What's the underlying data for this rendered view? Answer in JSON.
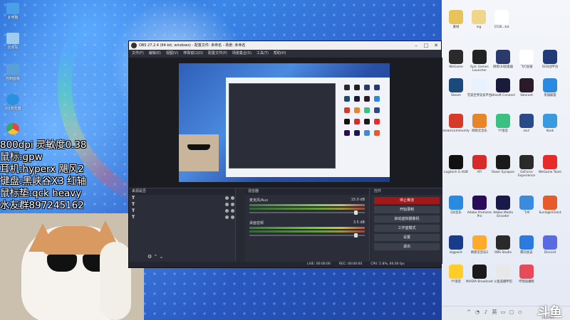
{
  "desktop": {
    "left_icons": [
      {
        "label": "此电脑",
        "icon": "computer-icon",
        "color": "#4aa0e8"
      },
      {
        "label": "回收站",
        "icon": "recycle-bin-icon",
        "color": "#9ecbf0"
      },
      {
        "label": "控制面板",
        "icon": "control-panel-icon",
        "color": "#5aa0d8"
      },
      {
        "label": "QQ浏览器",
        "icon": "qq-browser-icon",
        "color": "#2d8fe0"
      },
      {
        "label": "",
        "icon": "chrome-icon",
        "color": "#e04a3a"
      }
    ],
    "right_top_icons": [
      {
        "label": "素材",
        "icon": "folder-icon",
        "color": "#e8c25a"
      },
      {
        "label": "ing",
        "icon": "folder-icon",
        "color": "#f0d68a"
      },
      {
        "label": "1536...txt",
        "icon": "text-file-icon",
        "color": "#ffffff"
      }
    ],
    "right_icons": [
      {
        "label": "WeGame",
        "icon": "wegame-icon",
        "color": "#2a2a2a"
      },
      {
        "label": "Epic Games Launcher",
        "icon": "epic-icon",
        "color": "#222"
      },
      {
        "label": "网易UU加速器",
        "icon": "se-icon",
        "color": "#2a3a6a"
      },
      {
        "label": "飞行加速",
        "icon": "plane-icon",
        "color": "#ffffff"
      },
      {
        "label": "5E对战平台",
        "icon": "5e-icon",
        "color": "#203b78"
      },
      {
        "label": "Steam",
        "icon": "steam-icon",
        "color": "#1b4a7a"
      },
      {
        "label": "完美世界竞技平台",
        "icon": "perfect-icon",
        "color": "#e8f2ff"
      },
      {
        "label": "Ubisoft Connect",
        "icon": "ubisoft-icon",
        "color": "#1a1a3a"
      },
      {
        "label": "Valorant",
        "icon": "valorant-icon",
        "color": "#2a1a2a"
      },
      {
        "label": "英雄联盟",
        "icon": "league-icon",
        "color": "#2a8ae0"
      },
      {
        "label": "steamcommunity",
        "icon": "steamcommunity-icon",
        "color": "#d83a2a"
      },
      {
        "label": "网易云音乐",
        "icon": "cloudmusic-icon",
        "color": "#e8842a"
      },
      {
        "label": "YY语音",
        "icon": "yy-icon",
        "color": "#3ac080"
      },
      {
        "label": "osu!",
        "icon": "osu-icon",
        "color": "#2a4a8a"
      },
      {
        "label": "Kook",
        "icon": "kook-icon",
        "color": "#3a9ae0"
      },
      {
        "label": "Logitech G HUB",
        "icon": "ghub-icon",
        "color": "#111"
      },
      {
        "label": "ATI",
        "icon": "amd-icon",
        "color": "#d82a2a"
      },
      {
        "label": "Razer Synapse",
        "icon": "razer-icon",
        "color": "#1a1a1a"
      },
      {
        "label": "GeForce Experience",
        "icon": "nvidia-icon",
        "color": "#2a2a2a"
      },
      {
        "label": "WeGame Team",
        "icon": "team-icon",
        "color": "#e82a2a"
      },
      {
        "label": "QQ音乐",
        "icon": "qq-icon",
        "color": "#2a8ae0"
      },
      {
        "label": "Adobe Premiere Pro",
        "icon": "premiere-icon",
        "color": "#2a0a5a"
      },
      {
        "label": "Adobe Media Encoder",
        "icon": "media-encoder-icon",
        "color": "#1a1a4a"
      },
      {
        "label": "飞书",
        "icon": "feishu-icon",
        "color": "#3a8ae0"
      },
      {
        "label": "SunloginClient",
        "icon": "sunlogin-icon",
        "color": "#e85a2a"
      },
      {
        "label": "bigpoint",
        "icon": "bigpoint-icon",
        "color": "#1a3a8a"
      },
      {
        "label": "网易云音乐2",
        "icon": "cloudmusic2-icon",
        "color": "#ffaa2a"
      },
      {
        "label": "OBS Studio",
        "icon": "obs-icon",
        "color": "#2a2a2a"
      },
      {
        "label": "腾讯会议",
        "icon": "meeting-icon",
        "color": "#2a7ae0"
      },
      {
        "label": "Discord",
        "icon": "discord-icon",
        "color": "#5a6ae0"
      },
      {
        "label": "YY语音",
        "icon": "yy2-icon",
        "color": "#ffcc2a"
      },
      {
        "label": "NVIDIA Broadcast",
        "icon": "broadcast-icon",
        "color": "#1a1a1a"
      },
      {
        "label": "斗鱼直播伴侣",
        "icon": "douyu-tv-icon",
        "color": "#e8e8e8"
      },
      {
        "label": "哔哩直播姬",
        "icon": "bili-icon",
        "color": "#e84a5a"
      }
    ]
  },
  "overlay": {
    "lines": [
      "800dpi 灵敏度0.38",
      "鼠标:gpw",
      "耳机:hyperx 飓风2",
      "键盘:黑峡谷X3 红轴",
      "鼠标垫:qck heavy",
      "水友群897245162"
    ]
  },
  "obs": {
    "title": "OBS 27.2.4 (64-bit, windows) - 配置文件: 未命名 - 场景: 未命名",
    "menu": [
      "文件(F)",
      "编辑(E)",
      "视图(V)",
      "停靠窗口(D)",
      "配置文件(P)",
      "场景集合(S)",
      "工具(T)",
      "帮助(H)"
    ],
    "docks": {
      "scenes_header": "来源是否",
      "sources": [
        "T",
        "T",
        "T",
        "T"
      ],
      "sources_header": "来源",
      "mixer_header": "混音器",
      "controls_header": "控件"
    },
    "mixer": [
      {
        "name": "麦克风/Aux",
        "db": "15.0 dB"
      },
      {
        "name": "桌面音频",
        "db": "3.5 dB"
      }
    ],
    "controls": [
      "停止推流",
      "开始录制",
      "启动虚拟摄像机",
      "工作室模式",
      "设置",
      "退出"
    ],
    "status": {
      "live": "LIVE: 00:00:00",
      "rec": "REC: 00:00:00",
      "cpu": "CPU: 5.8%, 60.00 fps"
    }
  },
  "taskbar": {
    "clock": "2022/6/3"
  },
  "watermark": "斗鱼"
}
